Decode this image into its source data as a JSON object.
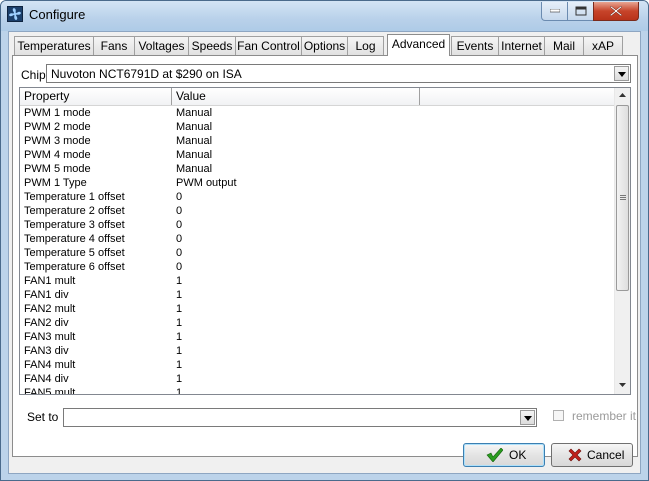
{
  "window": {
    "title": "Configure",
    "icon": "fan-app-icon"
  },
  "tabs": [
    {
      "label": "Temperatures"
    },
    {
      "label": "Fans"
    },
    {
      "label": "Voltages"
    },
    {
      "label": "Speeds"
    },
    {
      "label": "Fan Control"
    },
    {
      "label": "Options"
    },
    {
      "label": "Log"
    },
    {
      "label": "Advanced",
      "active": true
    },
    {
      "label": "Events"
    },
    {
      "label": "Internet"
    },
    {
      "label": "Mail"
    },
    {
      "label": "xAP"
    }
  ],
  "chip": {
    "label": "Chip",
    "value": "Nuvoton NCT6791D at $290 on ISA"
  },
  "table": {
    "columns": [
      "Property",
      "Value"
    ],
    "rows": [
      [
        "PWM 1 mode",
        "Manual"
      ],
      [
        "PWM 2 mode",
        "Manual"
      ],
      [
        "PWM 3 mode",
        "Manual"
      ],
      [
        "PWM 4 mode",
        "Manual"
      ],
      [
        "PWM 5 mode",
        "Manual"
      ],
      [
        "PWM 1 Type",
        "PWM output"
      ],
      [
        "Temperature 1 offset",
        "0"
      ],
      [
        "Temperature 2 offset",
        "0"
      ],
      [
        "Temperature 3 offset",
        "0"
      ],
      [
        "Temperature 4 offset",
        "0"
      ],
      [
        "Temperature 5 offset",
        "0"
      ],
      [
        "Temperature 6 offset",
        "0"
      ],
      [
        "FAN1 mult",
        "1"
      ],
      [
        "FAN1 div",
        "1"
      ],
      [
        "FAN2 mult",
        "1"
      ],
      [
        "FAN2 div",
        "1"
      ],
      [
        "FAN3 mult",
        "1"
      ],
      [
        "FAN3 div",
        "1"
      ],
      [
        "FAN4 mult",
        "1"
      ],
      [
        "FAN4 div",
        "1"
      ],
      [
        "FAN5 mult",
        "1"
      ]
    ]
  },
  "set_to": {
    "label": "Set to",
    "value": ""
  },
  "remember": {
    "label": "remember it",
    "checked": false,
    "enabled": false
  },
  "buttons": {
    "ok": "OK",
    "cancel": "Cancel"
  },
  "colors": {
    "ok_check": "#2a9d1f",
    "cancel_x": "#c0201a",
    "title_gradient_top": "#d3e4f5"
  }
}
